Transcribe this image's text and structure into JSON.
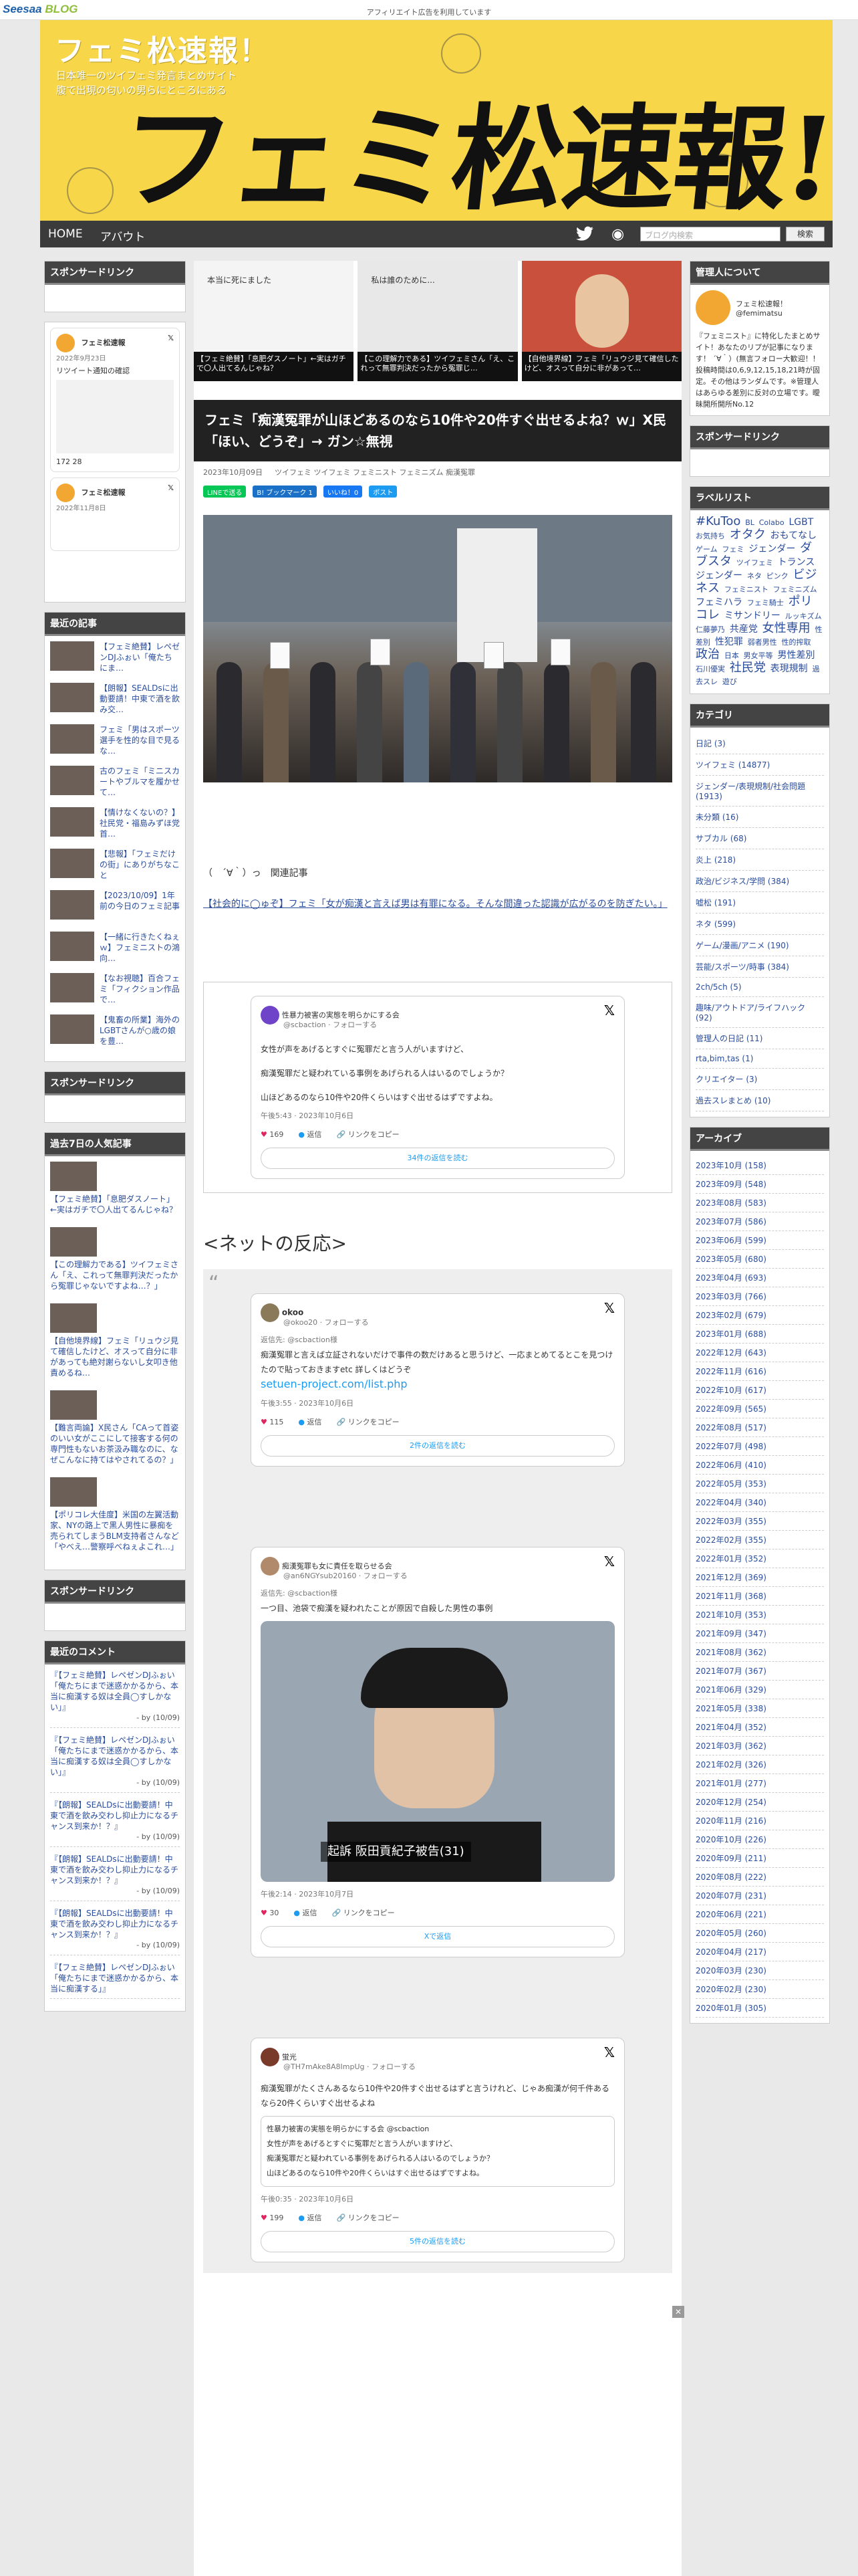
{
  "topbar": {
    "logo_a": "Seesaa",
    "logo_b": " BLOG",
    "notice": "アフィリエイト広告を利用しています"
  },
  "banner": {
    "title": "フェミ松速報！",
    "sub1": "日本唯一のツイフェミ発言まとめサイト",
    "sub2": "腹で出現の匂いの男らにところにある",
    "big": "フェミ松速報!"
  },
  "nav": {
    "home": "HOME",
    "about": "アバウト",
    "search_placeholder": "ブログ内検索",
    "search_button": "検索"
  },
  "left": {
    "sponsor1": "スポンサードリンク",
    "timeline": [
      {
        "name": "フェミ松速報",
        "date": "2022年9月23日",
        "text": "リツイート通知の確認",
        "stats": "172   28"
      },
      {
        "name": "フェミ松速報",
        "date": "2022年11月8日",
        "text": "",
        "stats": ""
      }
    ],
    "recent_head": "最近の記事",
    "recent": [
      "【フェミ絶賛】レペゼンDJふぉい「俺たちにま…",
      "【朗報】SEALDsに出動要請！中東で酒を飲み交…",
      "フェミ「男はスポーツ選手を性的な目で見るな…",
      "古のフェミ「ミニスカートやブルマを履かせて…",
      "【情けなくないの？】社民党・福島みずほ党首…",
      "【悲報】「フェミだけの街」にありがちなこと",
      "【2023/10/09】1年前の今日のフェミ記事",
      "【一緒に行きたくねぇｗ】フェミニストの鴻向…",
      "【なお視聴】百合フェミ「フィクション作品で…",
      "【鬼畜の所業】海外のLGBTさんが○歳の娘を豊…"
    ],
    "sponsor2": "スポンサードリンク",
    "popular_head": "過去7日の人気記事",
    "popular": [
      "【フェミ絶賛】「息肥ダスノート」←実はガチで〇人出てるんじゃね？",
      "【この理解力である】ツイフェミさん「え、これって無罪判決だったから冤罪じゃないですよね…？」",
      "【自他境界線】フェミ「リュウジ見て確信したけど、オスって自分に非があっても絶対謝らないし女叩き他責めるね…",
      "【難言両論】X民さん「CAって首姿のいい女がここにして接客する何の専門性もないお茶汲み職なのに、なぜこんなに持てはやされてるの？」",
      "【ポリコレ大佳度】米国の左翼活動家、NYの路上で黒人男性に暴痴を売られてしまうBLM支持者さんなど「やべえ…警察呼べねぇよこれ…」"
    ],
    "sponsor3": "スポンサードリンク",
    "comments_head": "最近のコメント",
    "comments": [
      {
        "text": "『【フェミ絶賛】レペゼンDJふぉい「俺たちにまで迷惑かかるから、本当に痴漢する奴は全員◯すしかない」』",
        "by": "- by  (10/09)"
      },
      {
        "text": "『【フェミ絶賛】レペゼンDJふぉい「俺たちにまで迷惑かかるから、本当に痴漢する奴は全員◯すしかない」』",
        "by": "- by  (10/09)"
      },
      {
        "text": "『【朗報】SEALDsに出動要請！中東で酒を飲み交わし抑止力になるチャンス到来か！？』",
        "by": "- by  (10/09)"
      },
      {
        "text": "『【朗報】SEALDsに出動要請！中東で酒を飲み交わし抑止力になるチャンス到来か！？』",
        "by": "- by  (10/09)"
      },
      {
        "text": "『【朗報】SEALDsに出動要請！中東で酒を飲み交わし抑止力になるチャンス到来か！？』",
        "by": "- by  (10/09)"
      },
      {
        "text": "『【フェミ絶賛】レペゼンDJふぉい「俺たちにまで迷惑かかるから、本当に痴漢する」』",
        "by": ""
      }
    ]
  },
  "main": {
    "features": [
      {
        "cap": "【フェミ絶賛】「息肥ダスノート」←実はガチで〇人出てるんじゃね？",
        "txt": "本当に死にました"
      },
      {
        "cap": "【この理解力である】ツイフェミさん「え、これって無罪判決だったから冤罪じ…",
        "txt": "私は誰のために..."
      },
      {
        "cap": "【自他境界線】フェミ「リュウジ見て確信したけど、オスって自分に非があって…",
        "txt": ""
      }
    ],
    "title": "フェミ「痴漢冤罪が山ほどあるのなら10件や20件すぐ出せるよね？ｗ」X民「ほい、どうぞ」→ ガン☆無視",
    "meta": "2023年10月09日 　 ツイフェミ  ツイフェミ フェミニスト フェミニズム 痴漢冤罪",
    "share_line": "LINEで送る",
    "share_b": "B! ブックマーク 1",
    "share_like": "いいね！0",
    "share_tw": "ポスト",
    "body1": "（　´∀｀）っ　関連記事",
    "body_link": "【社会的に◯ゅぞ】フェミ「女が痴漢と言えば男は有罪になる。そんな間違った認識が広がるのを防ぎたい。」",
    "tweet1": {
      "name": "性暴力被害の実態を明らかにする会",
      "handle": "@scbaction · フォローする",
      "l1": "女性が声をあげるとすぐに冤罪だと言う人がいますけど、",
      "l2": "痴漢冤罪だと疑われている事例をあげられる人はいるのでしょうか？",
      "l3": "山ほどあるのなら10件や20件くらいはすぐ出せるはずですよね。",
      "time": "午後5:43 · 2023年10月6日",
      "likes": "169",
      "reply": "返信",
      "copy": "リンクをコピー",
      "more": "34件の返信を読む"
    },
    "react_head": "<ネットの反応>",
    "tweet2": {
      "name": "okoo",
      "handle": "@okoo20 · フォローする",
      "reply_to": "返信先: @scbaction様",
      "l1": "痴漢冤罪と言えば立証されないだけで事件の数だけあると思うけど、一応まとめてるとこを見つけたので貼っておきますetc 詳しくはどうぞ",
      "link": "setuen-project.com/list.php",
      "time": "午後3:55 · 2023年10月6日",
      "likes": "115",
      "reply": "返信",
      "copy": "リンクをコピー",
      "more": "2件の返信を読む"
    },
    "tweet3": {
      "name": "痴漢冤罪も女に責任を取らせる会",
      "handle": "@an6NGYsub20160 · フォローする",
      "reply_to": "返信先: @scbaction様",
      "l1": "一つ目、池袋で痴漢を疑われたことが原因で自殺した男性の事例",
      "caption": "起訴 阪田貢紀子被告(31)",
      "time": "午後2:14 · 2023年10月7日",
      "likes": "30",
      "reply": "返信",
      "copy": "リンクをコピー",
      "more": "Xで返信"
    },
    "tweet4": {
      "name": "蛍光",
      "handle": "@TH7mAke8A8ImpUg · フォローする",
      "l1": "痴漢冤罪がたくさんあるなら10件や20件すぐ出せるはずと言うけれど、じゃあ痴漢が何千件あるなら20件くらいすぐ出せるよね",
      "q_name": "性暴力被害の実態を明らかにする会 @scbaction",
      "q1": "女性が声をあげるとすぐに冤罪だと言う人がいますけど、",
      "q2": "痴漢冤罪だと疑われている事例をあげられる人はいるのでしょうか？",
      "q3": "山ほどあるのなら10件や20件くらいはすぐ出せるはずですよね。",
      "time": "午後0:35 · 2023年10月6日",
      "likes": "199",
      "reply": "返信",
      "copy": "リンクをコピー",
      "more": "5件の返信を読む"
    }
  },
  "right": {
    "admin_head": "管理人について",
    "admin_name": "フェミ松速報！",
    "admin_handle": "@femimatsu",
    "admin_text": "『フェミニスト』に特化したまとめサイト！あなたのリプが記事になります！ ´∀｀）(無言フォロー大歓迎！！投稿時間は0,6,9,12,15,18,21時が固定。その他はランダムです。※管理人はあらゆる差別に反対の立場です。曖昧開所開所No.12",
    "sponsor": "スポンサードリンク",
    "tags_head": "ラベルリスト",
    "tags": [
      "#KuToo",
      "BL",
      "Colabo",
      "LGBT",
      "お気持ち",
      "オタク",
      "おもてなし",
      "ゲーム",
      "フェミ",
      "ジェンダー",
      "ダブスタ",
      "ツイフェミ",
      "トランスジェンダー",
      "ネタ",
      "ピンク",
      "ビジネス",
      "フェミニスト",
      "フェミニズム",
      "フェミハラ",
      "フェミ騎士",
      "ポリコレ",
      "ミサンドリー",
      "ルッキズム",
      "仁藤夢乃",
      "共産党",
      "女性専用",
      "性差別",
      "性犯罪",
      "弱者男性",
      "性的搾取",
      "政治",
      "日本",
      "男女平等",
      "男性差別",
      "石川優実",
      "社民党",
      "表現規制",
      "過去スレ",
      "遊び"
    ],
    "cats_head": "カテゴリ",
    "cats": [
      "日記 (3)",
      "ツイフェミ (14877)",
      "ジェンダー/表現規制/社会問題 (1913)",
      "未分類 (16)",
      "サブカル (68)",
      "炎上 (218)",
      "政治/ビジネス/学問 (384)",
      "嘘松 (191)",
      "ネタ (599)",
      "ゲーム/漫画/アニメ (190)",
      "芸能/スポーツ/時事 (384)",
      "2ch/5ch (5)",
      "趣味/アウトドア/ライフハック (92)",
      "管理人の日記 (11)",
      "rta,bim,tas (1)",
      "クリエイター (3)",
      "過去スレまとめ (10)"
    ],
    "arch_head": "アーカイブ",
    "arch": [
      "2023年10月 (158)",
      "2023年09月 (548)",
      "2023年08月 (583)",
      "2023年07月 (586)",
      "2023年06月 (599)",
      "2023年05月 (680)",
      "2023年04月 (693)",
      "2023年03月 (766)",
      "2023年02月 (679)",
      "2023年01月 (688)",
      "2022年12月 (643)",
      "2022年11月 (616)",
      "2022年10月 (617)",
      "2022年09月 (565)",
      "2022年08月 (517)",
      "2022年07月 (498)",
      "2022年06月 (410)",
      "2022年05月 (353)",
      "2022年04月 (340)",
      "2022年03月 (355)",
      "2022年02月 (355)",
      "2022年01月 (352)",
      "2021年12月 (369)",
      "2021年11月 (368)",
      "2021年10月 (353)",
      "2021年09月 (347)",
      "2021年08月 (362)",
      "2021年07月 (367)",
      "2021年06月 (329)",
      "2021年05月 (338)",
      "2021年04月 (352)",
      "2021年03月 (362)",
      "2021年02月 (326)",
      "2021年01月 (277)",
      "2020年12月 (254)",
      "2020年11月 (216)",
      "2020年10月 (226)",
      "2020年09月 (211)",
      "2020年08月 (222)",
      "2020年07月 (231)",
      "2020年06月 (221)",
      "2020年05月 (260)",
      "2020年04月 (217)",
      "2020年03月 (230)",
      "2020年02月 (230)",
      "2020年01月 (305)"
    ]
  },
  "colors": {
    "banner": "#f7d64a",
    "nav": "#3b3b3b",
    "link": "#2a4d9c"
  }
}
